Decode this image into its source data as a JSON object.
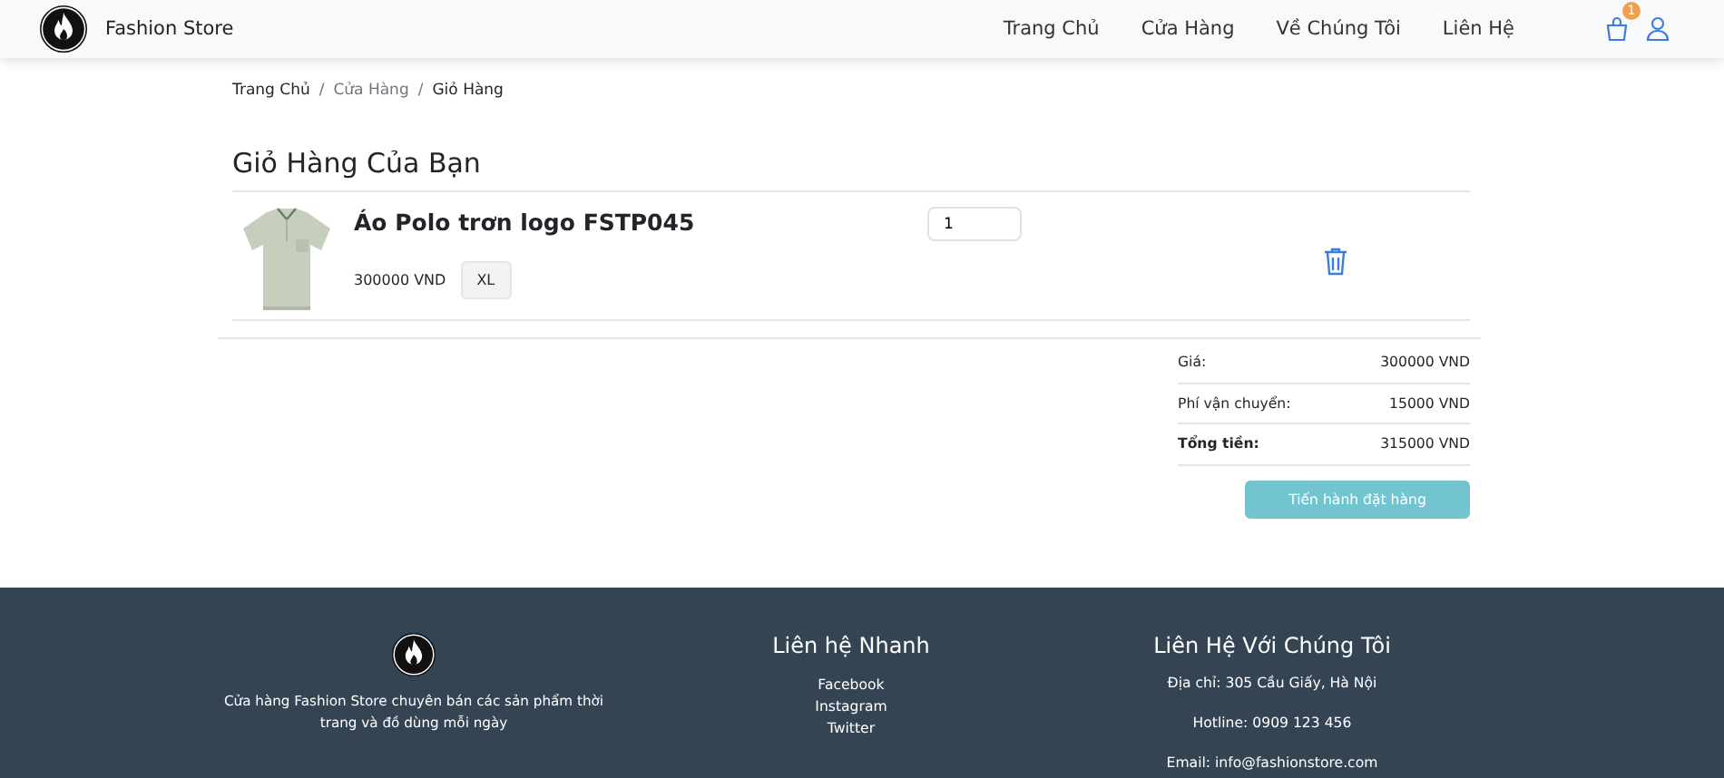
{
  "navbar": {
    "brand": "Fashion Store",
    "links": [
      {
        "label": "Trang Chủ"
      },
      {
        "label": "Cửa Hàng"
      },
      {
        "label": "Về Chúng Tôi"
      },
      {
        "label": "Liên Hệ"
      }
    ],
    "cart_count": "1"
  },
  "breadcrumb": {
    "separator": "/",
    "items": [
      {
        "label": "Trang Chủ",
        "muted": false
      },
      {
        "label": "Cửa Hàng",
        "muted": true
      },
      {
        "label": "Giỏ Hàng",
        "muted": false
      }
    ]
  },
  "cart": {
    "title": "Giỏ Hàng Của Bạn",
    "items": [
      {
        "name": "Áo Polo trơn logo FSTP045",
        "price": "300000 VND",
        "size": "XL",
        "quantity": "1"
      }
    ]
  },
  "summary": {
    "rows": [
      {
        "label": "Giá:",
        "value": "300000 VND",
        "bold": false
      },
      {
        "label": "Phí vận chuyển:",
        "value": "15000 VND",
        "bold": false
      },
      {
        "label": "Tổng tiền:",
        "value": "315000 VND",
        "bold": true
      }
    ],
    "checkout_button": "Tiến hành đặt hàng"
  },
  "footer": {
    "about": "Cửa hàng Fashion Store chuyên bán các sản phẩm thời trang và đồ dùng mỗi ngày",
    "quick_links": {
      "title": "Liên hệ Nhanh",
      "links": [
        "Facebook",
        "Instagram",
        "Twitter"
      ]
    },
    "contact": {
      "title": "Liên Hệ Với Chúng Tôi",
      "lines": [
        "Địa chỉ: 305 Cầu Giấy, Hà Nội",
        "Hotline: 0909 123 456",
        "Email: info@fashionstore.com"
      ]
    }
  }
}
